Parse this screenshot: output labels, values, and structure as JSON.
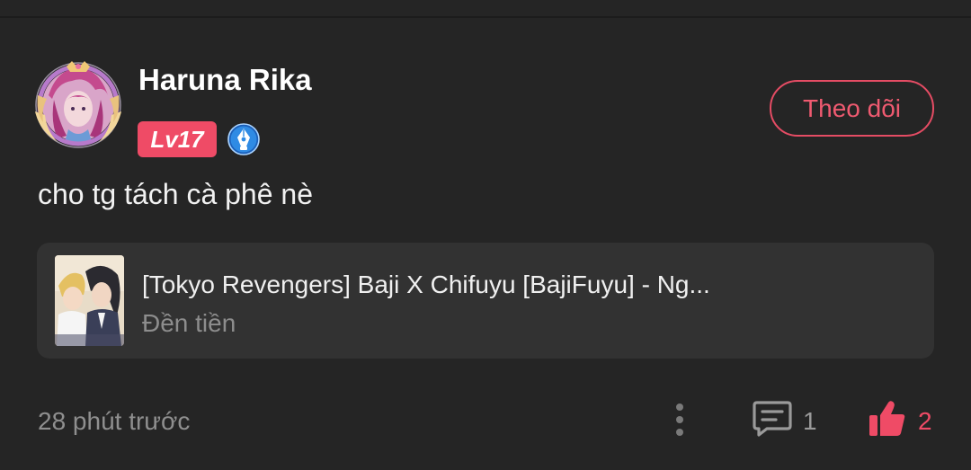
{
  "user": {
    "name": "Haruna Rika",
    "level": "Lv17",
    "avatar_icon": "user-avatar",
    "badge_icon": "pen-nib-icon"
  },
  "follow_button": {
    "label": "Theo dõi"
  },
  "comment": {
    "text": "cho tg tách cà phê nè"
  },
  "story": {
    "title": "[Tokyo Revengers] Baji X Chifuyu [BajiFuyu] - Ng...",
    "author": "Đền tiền",
    "cover_icon": "story-cover-image"
  },
  "footer": {
    "timestamp": "28 phút trước",
    "more_icon": "more-vertical-icon",
    "reply_icon": "comment-icon",
    "reply_count": "1",
    "like_icon": "thumbs-up-icon",
    "like_count": "2"
  },
  "colors": {
    "background": "#252525",
    "card": "#323232",
    "accent": "#ef4b66"
  }
}
